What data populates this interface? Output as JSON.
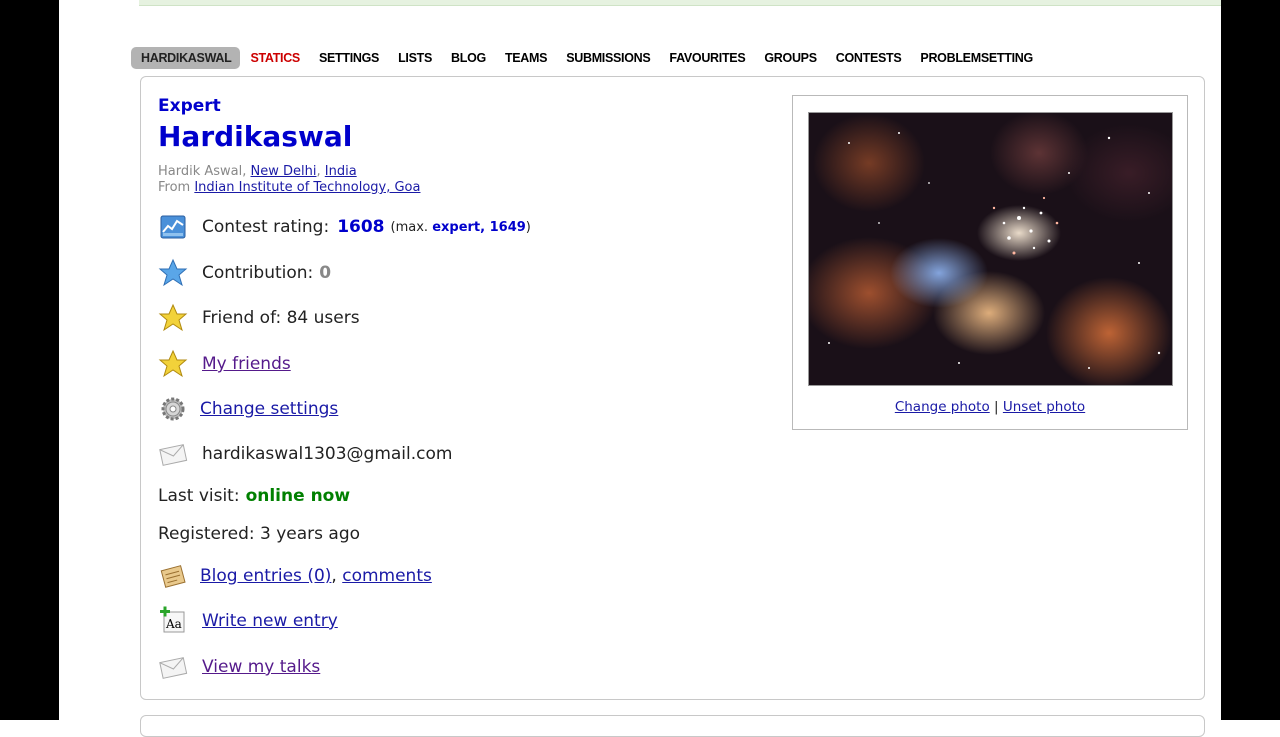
{
  "tabs": [
    {
      "label": "HARDIKASWAL",
      "active": true
    },
    {
      "label": "STATICS",
      "color": "#cc0000"
    },
    {
      "label": "SETTINGS"
    },
    {
      "label": "LISTS"
    },
    {
      "label": "BLOG"
    },
    {
      "label": "TEAMS"
    },
    {
      "label": "SUBMISSIONS"
    },
    {
      "label": "FAVOURITES"
    },
    {
      "label": "GROUPS"
    },
    {
      "label": "CONTESTS"
    },
    {
      "label": "PROBLEMSETTING"
    }
  ],
  "profile": {
    "rank": "Expert",
    "handle": "Hardikaswal",
    "name_prefix": "Hardik Aswal, ",
    "city": "New Delhi",
    "comma": ", ",
    "country": "India",
    "from_label": "From ",
    "organization": "Indian Institute of Technology, Goa",
    "rating_label": "Contest rating:",
    "rating": "1608",
    "max_prefix": "(max. ",
    "max_rank_rating": "expert, 1649",
    "max_suffix": ")",
    "contribution_label": "Contribution:",
    "contribution": "0",
    "friend_of": "Friend of: 84 users",
    "my_friends": "My friends",
    "change_settings": "Change settings",
    "email": "hardikaswal1303@gmail.com",
    "last_visit_label": "Last visit:",
    "last_visit": "online now",
    "registered": "Registered: 3 years ago",
    "blog_entries": "Blog entries (0)",
    "comments": "comments",
    "write_new_entry": "Write new entry",
    "view_my_talks": "View my talks"
  },
  "photo": {
    "change": "Change photo",
    "separator": " | ",
    "unset": "Unset photo"
  },
  "colors": {
    "rank_blue": "#0000cc",
    "online_green": "#008000",
    "link": "#1a1aa6"
  }
}
